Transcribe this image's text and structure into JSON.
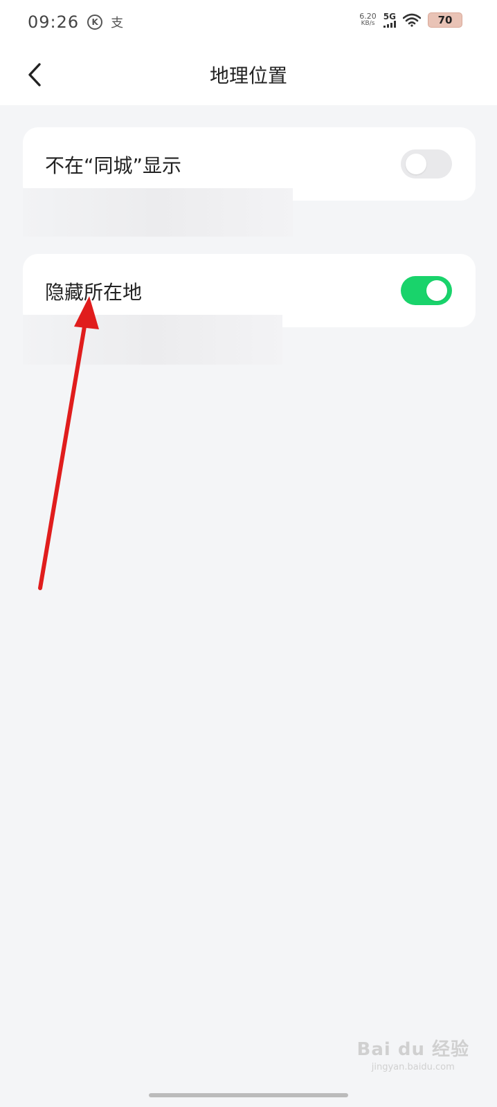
{
  "status_bar": {
    "time": "09:26",
    "k_icon": "K",
    "alipay_icon": "支",
    "net_speed_value": "6.20",
    "net_speed_unit": "KB/s",
    "network": "5G",
    "battery": "70"
  },
  "header": {
    "title": "地理位置"
  },
  "settings": [
    {
      "label": "不在“同城”显示",
      "enabled": false
    },
    {
      "label": "隐藏所在地",
      "enabled": true
    }
  ],
  "watermark": {
    "brand": "Bai du 经验",
    "url": "jingyan.baidu.com"
  },
  "colors": {
    "toggle_on": "#19d36b",
    "toggle_off": "#e9e9eb",
    "arrow": "#e01d1d",
    "background": "#f4f5f7"
  }
}
